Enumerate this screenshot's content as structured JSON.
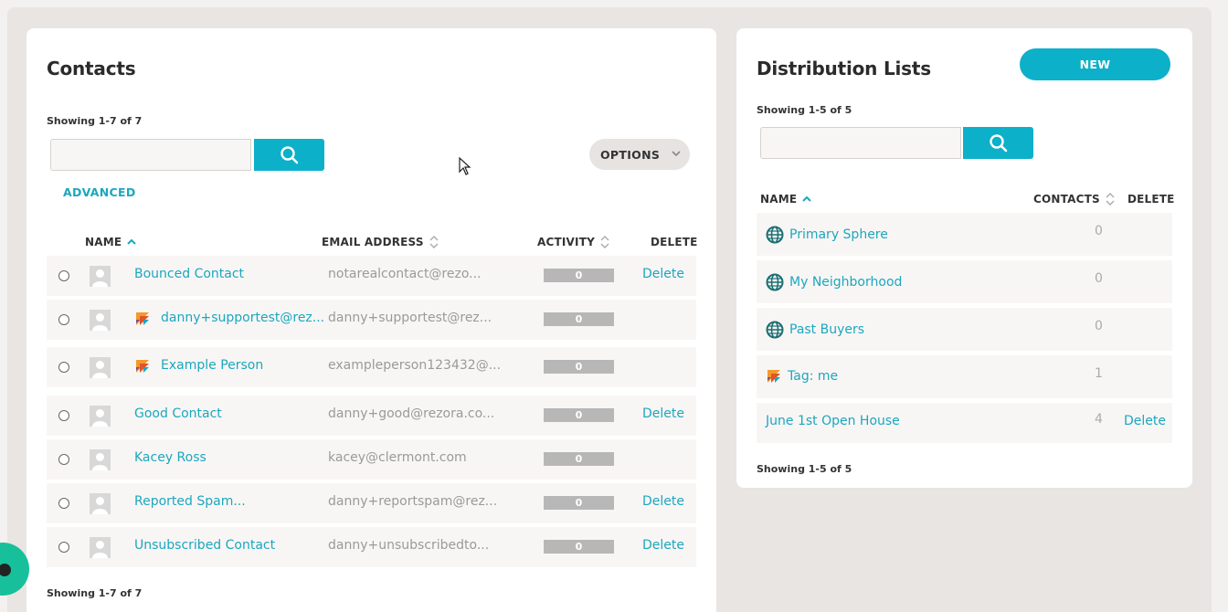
{
  "contacts": {
    "title": "Contacts",
    "showing_top": "Showing 1-7 of 7",
    "showing_bottom": "Showing 1-7 of 7",
    "advanced_label": "ADVANCED",
    "options_label": "OPTIONS",
    "columns": {
      "name": "NAME",
      "email": "EMAIL ADDRESS",
      "activity": "ACTIVITY",
      "delete": "DELETE"
    },
    "rows": [
      {
        "name": "Bounced Contact",
        "email": "notarealcontact@rezo...",
        "activity": "0",
        "delete": "Delete",
        "rezora_icon": false
      },
      {
        "name": "danny+supportest@rez...",
        "email": "danny+supportest@rez...",
        "activity": "0",
        "delete": "",
        "rezora_icon": true
      },
      {
        "name": "Example Person",
        "email": "exampleperson123432@...",
        "activity": "0",
        "delete": "",
        "rezora_icon": true
      },
      {
        "name": "Good Contact",
        "email": "danny+good@rezora.co...",
        "activity": "0",
        "delete": "Delete",
        "rezora_icon": false
      },
      {
        "name": "Kacey Ross",
        "email": "kacey@clermont.com",
        "activity": "0",
        "delete": "",
        "rezora_icon": false
      },
      {
        "name": "Reported Spam...",
        "email": "danny+reportspam@rez...",
        "activity": "0",
        "delete": "Delete",
        "rezora_icon": false
      },
      {
        "name": "Unsubscribed Contact",
        "email": "danny+unsubscribedto...",
        "activity": "0",
        "delete": "Delete",
        "rezora_icon": false
      }
    ]
  },
  "lists": {
    "title": "Distribution Lists",
    "new_label": "NEW",
    "showing_top": "Showing 1-5 of 5",
    "showing_bottom": "Showing 1-5 of 5",
    "columns": {
      "name": "NAME",
      "contacts": "CONTACTS",
      "delete": "DELETE"
    },
    "rows": [
      {
        "name": "Primary Sphere",
        "count": "0",
        "delete": "",
        "icon": "globe-icon"
      },
      {
        "name": "My Neighborhood",
        "count": "0",
        "delete": "",
        "icon": "globe-icon"
      },
      {
        "name": "Past Buyers",
        "count": "0",
        "delete": "",
        "icon": "globe-icon"
      },
      {
        "name": "Tag: me",
        "count": "1",
        "delete": "",
        "icon": "rezora-tag-icon"
      },
      {
        "name": "June 1st Open House",
        "count": "4",
        "delete": "Delete",
        "icon": ""
      }
    ]
  },
  "colors": {
    "accent": "#0cb0c9",
    "link": "#1ba7be",
    "row_bg": "#f8f6f5",
    "chat": "#17c09a"
  }
}
